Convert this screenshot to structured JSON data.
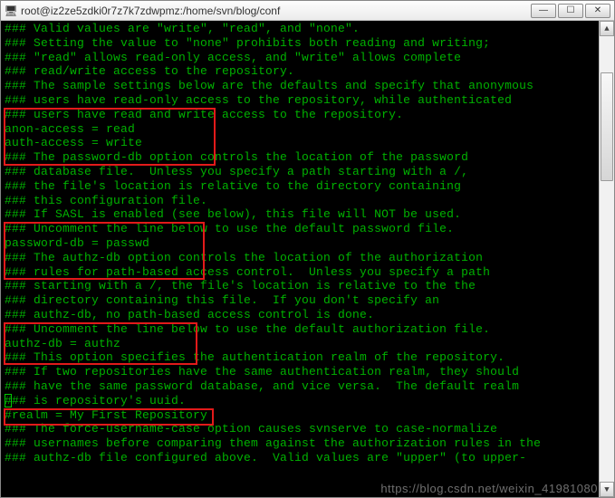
{
  "window": {
    "title": "root@iz2ze5zdki0r7z7k7zdwpmz:/home/svn/blog/conf",
    "icon_glyph": "🖥"
  },
  "controls": {
    "min_glyph": "—",
    "max_glyph": "☐",
    "close_glyph": "✕"
  },
  "scrollbar": {
    "up_glyph": "▲",
    "down_glyph": "▼"
  },
  "watermark": "https://blog.csdn.net/weixin_41981080",
  "lines": [
    "### Valid values are \"write\", \"read\", and \"none\".",
    "### Setting the value to \"none\" prohibits both reading and writing;",
    "### \"read\" allows read-only access, and \"write\" allows complete",
    "### read/write access to the repository.",
    "### The sample settings below are the defaults and specify that anonymous",
    "### users have read-only access to the repository, while authenticated",
    "### users have read and write access to the repository.",
    "anon-access = read",
    "auth-access = write",
    "### The password-db option controls the location of the password",
    "### database file.  Unless you specify a path starting with a /,",
    "### the file's location is relative to the directory containing",
    "### this configuration file.",
    "### If SASL is enabled (see below), this file will NOT be used.",
    "### Uncomment the line below to use the default password file.",
    "password-db = passwd",
    "### The authz-db option controls the location of the authorization",
    "### rules for path-based access control.  Unless you specify a path",
    "### starting with a /, the file's location is relative to the the",
    "### directory containing this file.  If you don't specify an",
    "### authz-db, no path-based access control is done.",
    "### Uncomment the line below to use the default authorization file.",
    "authz-db = authz",
    "### This option specifies the authentication realm of the repository.",
    "### If two repositories have the same authentication realm, they should",
    "### have the same password database, and vice versa.  The default realm",
    "### is repository's uuid.",
    "#realm = My First Repository",
    "### The force-username-case option causes svnserve to case-normalize",
    "### usernames before comparing them against the authorization rules in the",
    "### authz-db file configured above.  Valid values are \"upper\" (to upper-"
  ]
}
